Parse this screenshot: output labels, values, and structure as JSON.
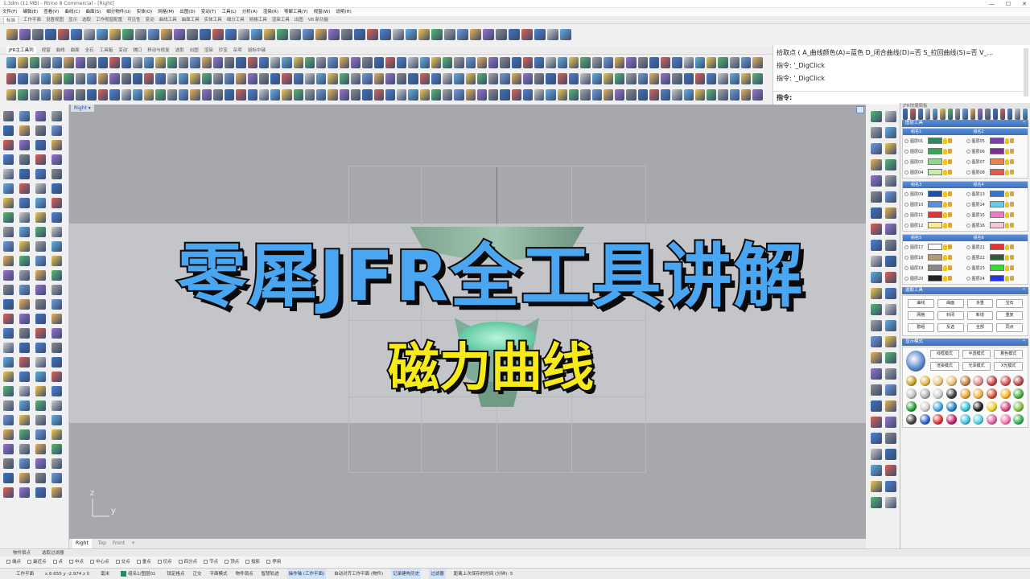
{
  "window": {
    "title": "1.3dm (11 MB) - Rhino 8 Commercial - [Right]"
  },
  "menu": [
    "文件(F)",
    "编辑(E)",
    "查看(V)",
    "曲线(C)",
    "曲面(S)",
    "细分物件(U)",
    "实体(O)",
    "网格(M)",
    "出图(D)",
    "变动(T)",
    "工具(L)",
    "分析(A)",
    "渲染(R)",
    "零犀工具(Y)",
    "视窗(W)",
    "说明(H)"
  ],
  "toolbar_tabs": [
    "标准",
    "工作平面",
    "设置视图",
    "显示",
    "选取",
    "工作视窗配置",
    "可见性",
    "变动",
    "曲线工具",
    "曲面工具",
    "实体工具",
    "细分工具",
    "网格工具",
    "渲染工具",
    "出图",
    "V8 新功能"
  ],
  "jfr_tabs": [
    "JFR主工具列",
    "视窗",
    "曲线",
    "曲面",
    "全石",
    "工具箱",
    "变动",
    "辅口",
    "移动与修复",
    "选取",
    "出图",
    "渲染",
    "珍宝",
    "杂项",
    "鼠标中键"
  ],
  "command": {
    "line1": "拾取点 ( A_曲线颜色(A)=蓝色  D_闭合曲线(D)=否  S_拉回曲线(S)=否  V_...",
    "line2": "指令: '_DigClick",
    "line3": "指令: '_DigClick",
    "prompt": "指令:"
  },
  "viewport": {
    "name": "Right",
    "axis_z": "z",
    "axis_y": "y",
    "tabs": [
      "Right",
      "Top",
      "Front",
      "+"
    ]
  },
  "overlay": {
    "title": "零犀JFR全工具讲解",
    "subtitle": "磁力曲线"
  },
  "panel": {
    "title": "JFR快捷面板",
    "layer_tools_header": "图层工具",
    "groups": [
      {
        "left_name": "组名1",
        "right_name": "组名2",
        "layers": [
          [
            "图层01",
            "#2a8a62"
          ],
          [
            "图层05",
            "#7b3fb0"
          ],
          [
            "图层02",
            "#3aa655"
          ],
          [
            "图层06",
            "#7a2f8f"
          ],
          [
            "图层03",
            "#8fd68f"
          ],
          [
            "图层07",
            "#e8864a"
          ],
          [
            "图层04",
            "#c6eea8"
          ],
          [
            "图层08",
            "#e05a52"
          ]
        ]
      },
      {
        "left_name": "组名3",
        "right_name": "组名4",
        "layers": [
          [
            "图层09",
            "#1a4fa8"
          ],
          [
            "图层13",
            "#3576cc"
          ],
          [
            "图层10",
            "#5b8fe0"
          ],
          [
            "图层14",
            "#66ccee"
          ],
          [
            "图层11",
            "#e83333"
          ],
          [
            "图层15",
            "#f07ac0"
          ],
          [
            "图层12",
            "#ffeb8a"
          ],
          [
            "图层16",
            "#f5c6d8"
          ]
        ]
      },
      {
        "left_name": "组名5",
        "right_name": "组名6",
        "layers": [
          [
            "图层17",
            "#ffffff"
          ],
          [
            "图层21",
            "#e83333"
          ],
          [
            "图层18",
            "#b39a70"
          ],
          [
            "图层22",
            "#2f5d3a"
          ],
          [
            "图层19",
            "#888888"
          ],
          [
            "图层23",
            "#33dd33"
          ],
          [
            "图层20",
            "#222222"
          ],
          [
            "图层24",
            "#2233ee"
          ]
        ]
      }
    ],
    "select_tools_header": "选取工具",
    "select_buttons": [
      "曲线",
      "曲面",
      "多重",
      "宝石",
      "网格",
      "封闭",
      "新增",
      "重复",
      "群组",
      "反选",
      "全部",
      "同点"
    ],
    "display_header": "显示模式",
    "display_buttons": [
      "线框模式",
      "半透模式",
      "着色模式",
      "渲染模式",
      "光泽模式",
      "X光模式"
    ],
    "sphere_colors": [
      "#c9a227",
      "#e0b84a",
      "#f0c87a",
      "#e6c070",
      "#c08040",
      "#d98c8c",
      "#c04040",
      "#d85050",
      "#b84848",
      "#c0c0c0",
      "#b0b0b0",
      "#d0d0d0",
      "#3a3a3a",
      "#e8a030",
      "#f0b040",
      "#d05030",
      "#ffb020",
      "#40b040",
      "#20a030",
      "#d0d0d0",
      "#40a0e0",
      "#2080c0",
      "#30c0d0",
      "#1a1a1a",
      "#f0d020",
      "#e04080",
      "#80c040",
      "#404040",
      "#3060d0",
      "#e03030",
      "#c02060",
      "#40c0e0",
      "#50d0e0",
      "#e060a0",
      "#ff70b0",
      "#30b050"
    ]
  },
  "status": {
    "osnap_tabs": [
      "物件锁点",
      "选取过滤器"
    ],
    "osnaps": [
      "端点",
      "最近点",
      "点",
      "中点",
      "中心点",
      "交点",
      "垂点",
      "切点",
      "四分点",
      "节点",
      "顶点",
      "投影",
      "停用"
    ],
    "plane": "工作平面",
    "coords": "x 6.655  y -2.974  z 0",
    "units": "毫米",
    "layer": "组名1/图层01",
    "items": [
      "锁定格点",
      "正交",
      "平面模式",
      "物件锁点",
      "智慧轨迹",
      "操作轴 (工作平面)",
      "自动对齐工作平面 (物件)",
      "记录建构历史",
      "过滤器",
      "距离上次保存的时间 (分钟): 5"
    ]
  }
}
